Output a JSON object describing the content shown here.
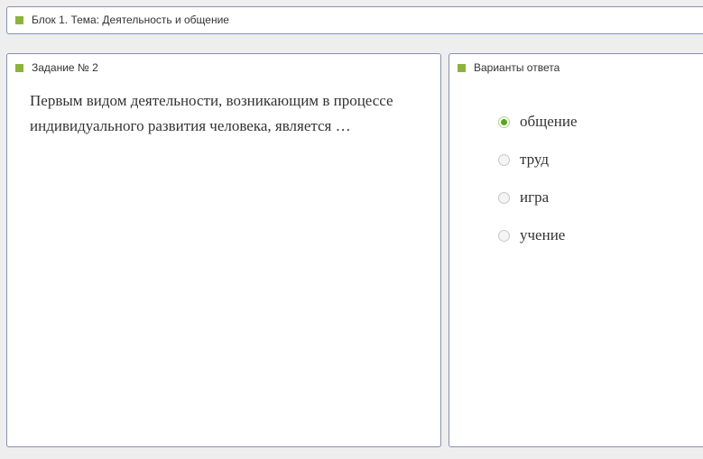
{
  "block_header": {
    "title": "Блок 1. Тема: Деятельность и общение"
  },
  "task": {
    "title": "Задание № 2",
    "question": "Первым видом деятельности, возникающим в процессе индивидуального развития человека, является …"
  },
  "answers": {
    "title": "Варианты ответа",
    "selected_index": 0,
    "options": [
      {
        "label": "общение",
        "selected": true
      },
      {
        "label": "труд",
        "selected": false
      },
      {
        "label": "игра",
        "selected": false
      },
      {
        "label": "учение",
        "selected": false
      }
    ]
  },
  "colors": {
    "accent_marker": "#8cb33c",
    "radio_selected": "#5aa61e",
    "panel_border": "#8a8fb0"
  }
}
